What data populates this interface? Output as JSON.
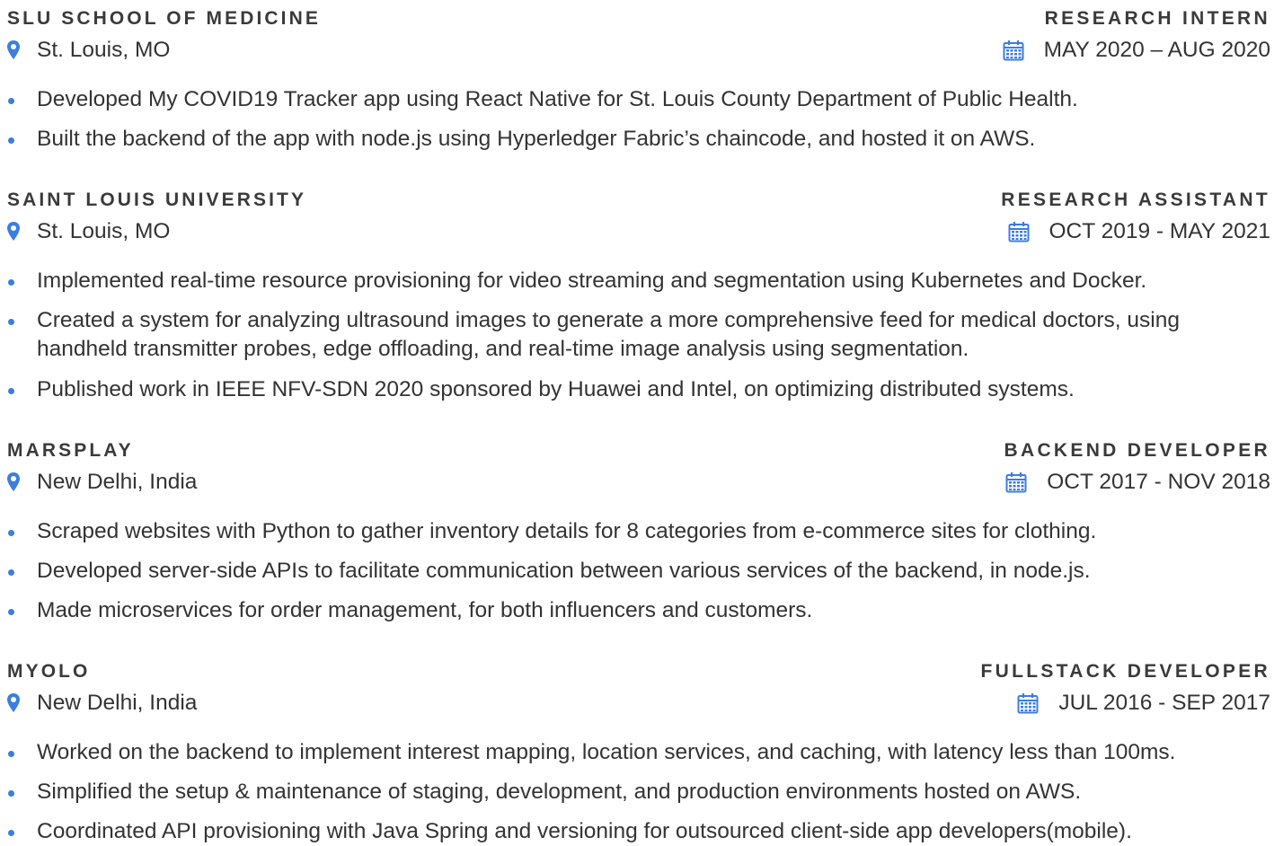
{
  "icons": {
    "location": "map-pin-icon",
    "date": "calendar-icon"
  },
  "colors": {
    "accent": "#3b7de0",
    "text": "#333333"
  },
  "jobs": [
    {
      "company": "SLU SCHOOL OF MEDICINE",
      "role": "RESEARCH INTERN",
      "location": "St. Louis, MO",
      "dates": "MAY 2020 – AUG 2020",
      "bullets": [
        "Developed My COVID19 Tracker app using React Native for St. Louis County Department of Public Health.",
        "Built the backend of the app with node.js using Hyperledger Fabric’s chaincode, and hosted it on AWS."
      ]
    },
    {
      "company": "SAINT LOUIS UNIVERSITY",
      "role": "RESEARCH ASSISTANT",
      "location": "St. Louis, MO",
      "dates": "OCT 2019 - MAY 2021",
      "bullets": [
        "Implemented real-time resource provisioning for video streaming and segmentation using Kubernetes and Docker.",
        "Created a system for analyzing ultrasound images to generate a more comprehensive feed for medical doctors, using handheld transmitter probes, edge offloading, and real-time image analysis using segmentation.",
        "Published work in IEEE NFV-SDN 2020 sponsored by Huawei and Intel, on optimizing distributed systems."
      ]
    },
    {
      "company": "MARSPLAY",
      "role": "BACKEND DEVELOPER",
      "location": "New Delhi, India",
      "dates": "OCT 2017 - NOV 2018",
      "bullets": [
        "Scraped websites with Python to gather inventory details for 8 categories from e-commerce sites for clothing.",
        "Developed server-side APIs to facilitate communication between various services of the backend, in node.js.",
        "Made microservices for order management, for both influencers and customers."
      ]
    },
    {
      "company": "MYOLO",
      "role": "FULLSTACK DEVELOPER",
      "location": "New Delhi, India",
      "dates": "JUL 2016 - SEP 2017",
      "bullets": [
        "Worked on the backend to implement interest mapping, location services, and caching, with latency less than 100ms.",
        "Simplified the setup & maintenance of staging, development, and production environments hosted on AWS.",
        "Coordinated API provisioning with Java Spring and versioning for outsourced client-side app developers(mobile)."
      ]
    }
  ]
}
